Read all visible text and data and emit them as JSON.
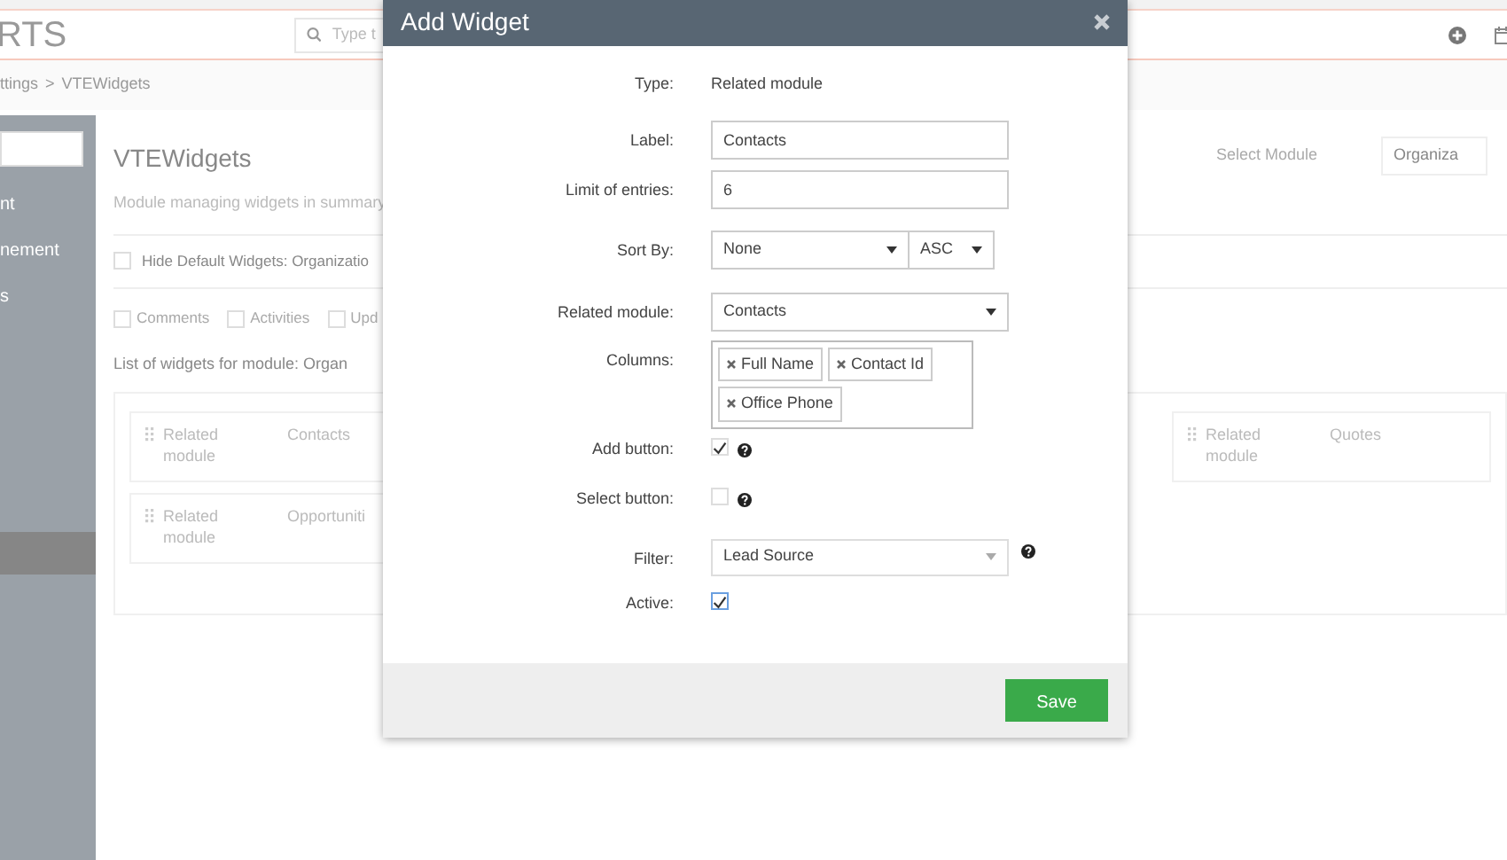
{
  "header": {
    "logo": "RTS",
    "search_placeholder": "Type t"
  },
  "breadcrumb": {
    "items": [
      "ttings",
      "VTEWidgets"
    ],
    "separator": ">"
  },
  "sidebar": {
    "items": [
      {
        "label": "nt",
        "selected": false
      },
      {
        "label": "nement",
        "selected": false
      },
      {
        "label": "s",
        "selected": false
      },
      {
        "selected": true
      }
    ]
  },
  "page": {
    "title": "VTEWidgets",
    "description": "Module managing widgets in summary",
    "select_module": {
      "label": "Select Module",
      "value": "Organiza"
    },
    "hide_default": {
      "label": "Hide Default Widgets: Organizatio",
      "checked": false
    },
    "widget_types": [
      {
        "label": "Comments",
        "checked": false
      },
      {
        "label": "Activities",
        "checked": false
      },
      {
        "label": "Upd",
        "checked": false
      }
    ],
    "list_title": "List of widgets for module: Organ",
    "widget_columns": [
      {
        "widgets": [
          {
            "type": "Related module",
            "name": "Contacts"
          },
          {
            "type": "Related module",
            "name": "Opportuniti"
          }
        ]
      },
      {
        "widgets": [
          {
            "type": "Related module",
            "name": "Quotes"
          }
        ]
      }
    ]
  },
  "modal": {
    "title": "Add Widget",
    "fields": [
      {
        "kind": "static",
        "label": "Type:",
        "value": "Related module"
      },
      {
        "kind": "text",
        "label": "Label:",
        "value": "Contacts"
      },
      {
        "kind": "text",
        "label": "Limit of entries:",
        "value": "6"
      },
      {
        "kind": "sort",
        "label": "Sort By:",
        "value": "None",
        "order": "ASC"
      },
      {
        "kind": "select",
        "label": "Related module:",
        "value": "Contacts"
      },
      {
        "kind": "tags",
        "label": "Columns:",
        "tags": [
          "Full Name",
          "Contact Id",
          "Office Phone"
        ]
      },
      {
        "kind": "checkbox",
        "label": "Add button:",
        "checked": true,
        "help": true
      },
      {
        "kind": "checkbox",
        "label": "Select button:",
        "checked": false,
        "help": true
      },
      {
        "kind": "select2",
        "label": "Filter:",
        "value": "Lead Source",
        "help": true
      },
      {
        "kind": "checkbox",
        "label": "Active:",
        "checked": true
      }
    ],
    "save": "Save"
  }
}
